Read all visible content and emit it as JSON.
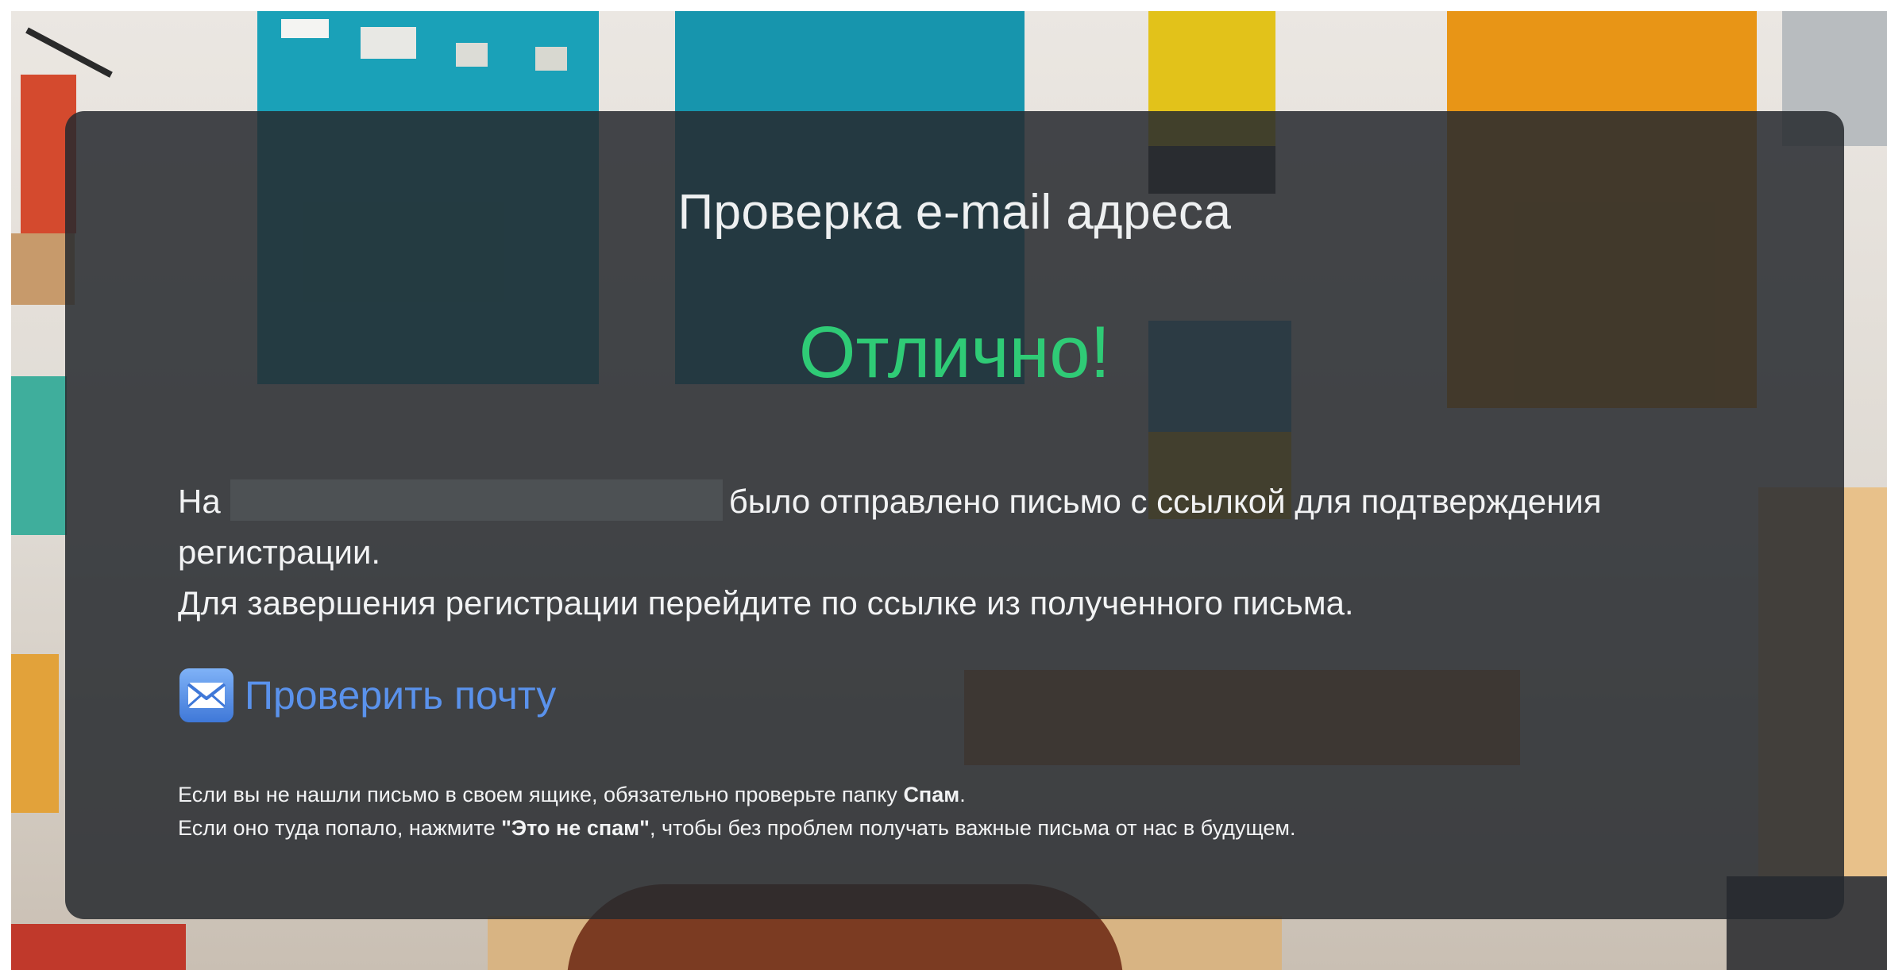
{
  "page": {
    "title": "Проверка e-mail адреса",
    "success_text": "Отлично!"
  },
  "message": {
    "prefix": "На",
    "email_redacted": "",
    "line1_rest": "было отправлено письмо с ссылкой для подтверждения",
    "line1_cont": "регистрации.",
    "line2": "Для завершения регистрации перейдите по ссылке из полученного письма."
  },
  "check_mail": {
    "label": "Проверить почту",
    "icon": "envelope-icon"
  },
  "note": {
    "line1_prefix": "Если вы не нашли письмо в своем ящике, обязательно проверьте папку",
    "line1_bold": "Спам",
    "line1_suffix": ".",
    "line2_prefix": "Если оно туда попало, нажмите",
    "line2_bold": "\"Это не спам\"",
    "line2_suffix": ", чтобы без проблем получать важные письма от нас в будущем."
  },
  "colors": {
    "panel": "#262a2e",
    "success": "#2fcb76",
    "link": "#5a92ec",
    "text": "#f2f3f4"
  }
}
